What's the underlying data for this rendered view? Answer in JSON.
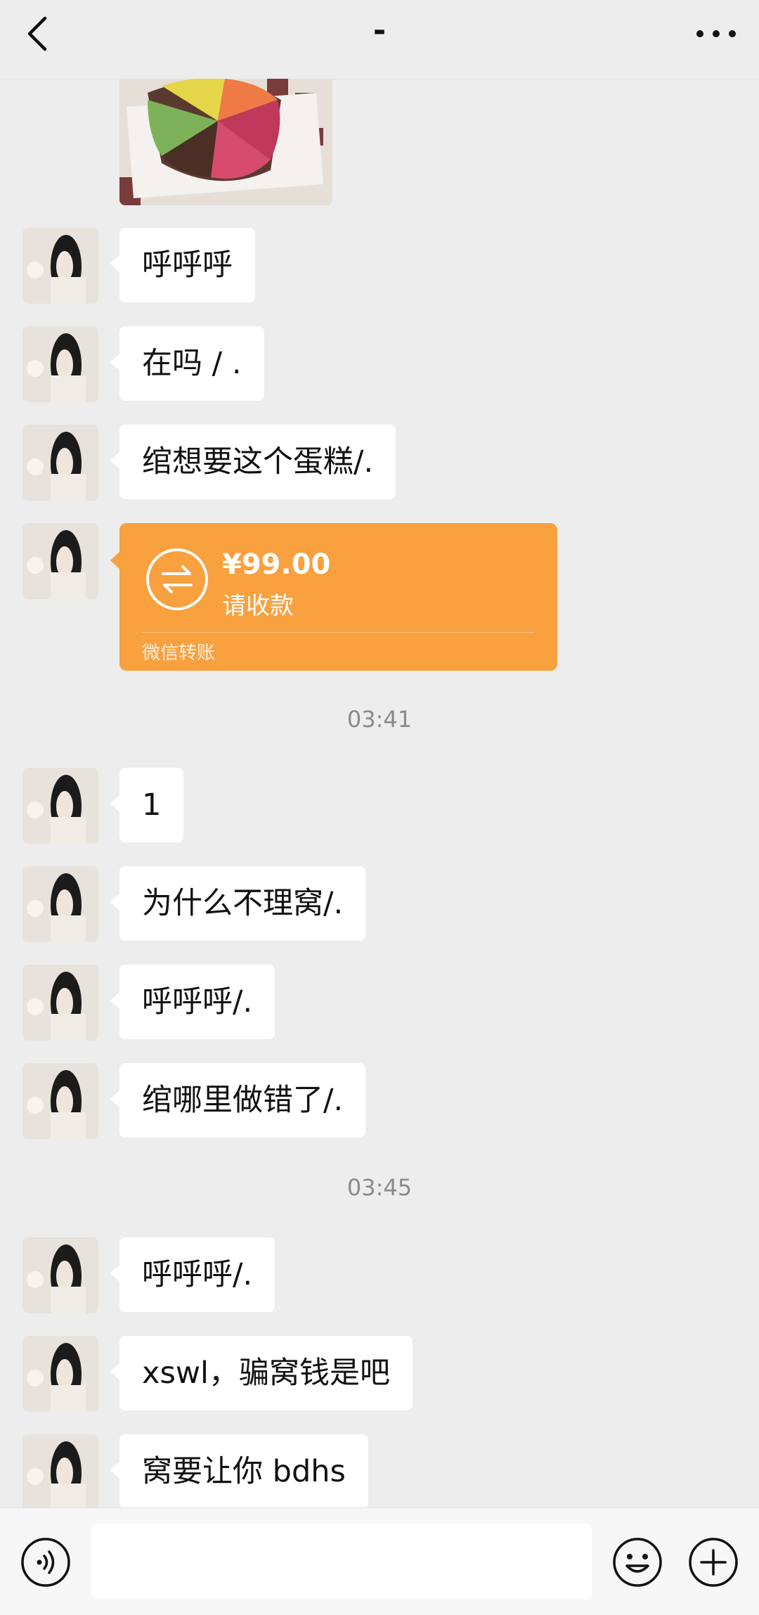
{
  "header": {
    "title": "-",
    "back_icon": "chevron-left-icon",
    "more_icon": "more-dots-icon"
  },
  "messages": [
    {
      "text": "呼呼呼"
    },
    {
      "text": "在吗 / ."
    },
    {
      "text": "绾想要这个蛋糕/."
    },
    {
      "text": "1"
    },
    {
      "text": "为什么不理窝/."
    },
    {
      "text": "呼呼呼/."
    },
    {
      "text": "绾哪里做错了/."
    },
    {
      "text": "呼呼呼/."
    },
    {
      "text": "xswl，骗窝钱是吧"
    },
    {
      "text": "窝要让你 bdhs"
    }
  ],
  "transfer": {
    "amount": "¥99.00",
    "status": "请收款",
    "footer": "微信转账",
    "color": "#f9a03f"
  },
  "timestamps": [
    "03:41",
    "03:45"
  ],
  "input_bar": {
    "input_value": "",
    "voice_icon": "voice-icon",
    "emoji_icon": "emoji-icon",
    "plus_icon": "plus-icon"
  }
}
